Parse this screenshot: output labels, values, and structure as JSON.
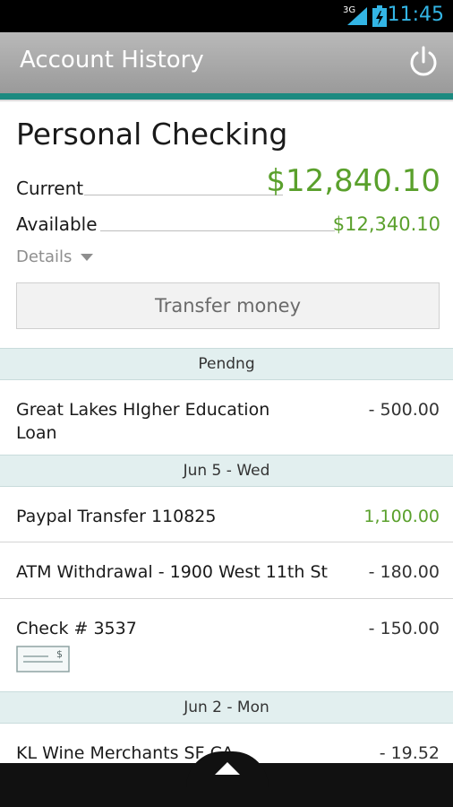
{
  "status_bar": {
    "network": "3G",
    "time": "11:45"
  },
  "app_bar": {
    "title": "Account History",
    "power_icon": "power-icon"
  },
  "account": {
    "name": "Personal Checking",
    "current_label": "Current",
    "current_amount": "$12,840.10",
    "available_label": "Available",
    "available_amount": "$12,340.10",
    "details_label": "Details",
    "transfer_label": "Transfer money"
  },
  "colors": {
    "accent": "#1c8a80",
    "positive": "#5aa02c",
    "section_bg": "#e2efef"
  },
  "sections": [
    {
      "label": "Pendng",
      "transactions": [
        {
          "desc": "Great Lakes HIgher Education Loan",
          "amount": "- 500.00"
        }
      ]
    },
    {
      "label": "Jun 5 - Wed",
      "transactions": [
        {
          "desc": "Paypal Transfer 110825",
          "amount": "1,100.00"
        },
        {
          "desc": "ATM Withdrawal - 1900 West 11th St",
          "amount": "- 180.00"
        },
        {
          "desc": "Check # 3537",
          "amount": "- 150.00",
          "icon": "check-image-icon"
        }
      ]
    },
    {
      "label": "Jun 2 - Mon",
      "transactions": [
        {
          "desc": "KL Wine Merchants SF CA",
          "amount": "- 19.52"
        }
      ]
    }
  ],
  "bottom_handle_icon": "chevron-up-icon"
}
